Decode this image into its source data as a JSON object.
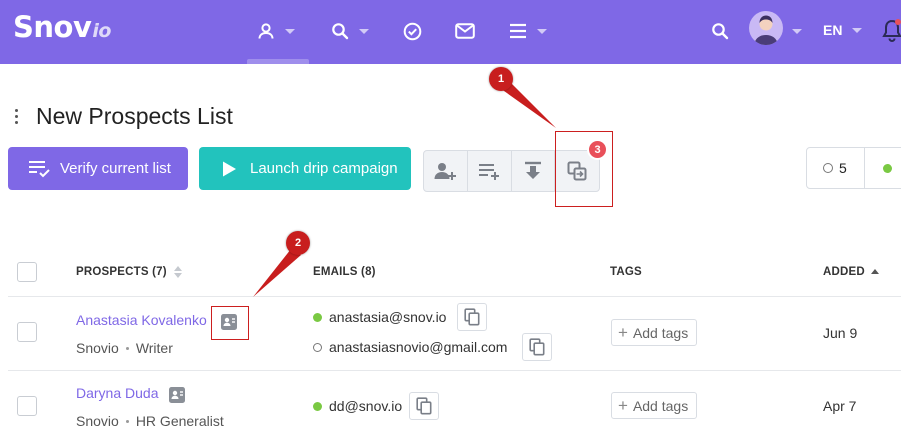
{
  "app": {
    "logo_main": "Snov",
    "logo_suffix": "io",
    "language": "EN"
  },
  "nav": {
    "items": [
      {
        "icon": "prospects-icon",
        "has_caret": true
      },
      {
        "icon": "search-icon",
        "has_caret": true
      },
      {
        "icon": "check-circle-icon",
        "has_caret": false
      },
      {
        "icon": "mail-icon",
        "has_caret": false
      },
      {
        "icon": "menu-icon",
        "has_caret": true
      }
    ],
    "right_icons": [
      "search-icon",
      "avatar",
      "bell-icon"
    ]
  },
  "page": {
    "title": "New Prospects List"
  },
  "toolbar": {
    "verify_label": "Verify current list",
    "launch_label": "Launch drip campaign",
    "tools": [
      "add-prospect-icon",
      "add-to-list-icon",
      "download-icon",
      "copy-move-icon"
    ],
    "tool_badge": "3",
    "counter_unverified": "5"
  },
  "table": {
    "headers": {
      "prospects": "PROSPECTS (7)",
      "emails": "EMAILS (8)",
      "tags": "TAGS",
      "added": "ADDED"
    },
    "rows": [
      {
        "name": "Anastasia Kovalenko",
        "company": "Snovio",
        "position": "Writer",
        "emails": [
          {
            "address": "anastasia@snov.io",
            "status": "valid"
          },
          {
            "address": "anastasiasnovio@gmail.com",
            "status": "unknown"
          }
        ],
        "tags_label": "Add tags",
        "added": "Jun 9"
      },
      {
        "name": "Daryna Duda",
        "company": "Snovio",
        "position": "HR Generalist",
        "emails": [
          {
            "address": "dd@snov.io",
            "status": "valid"
          }
        ],
        "tags_label": "Add tags",
        "added": "Apr 7"
      }
    ]
  },
  "annotations": {
    "marker_1": "1",
    "marker_2": "2",
    "colors": {
      "marker": "#c81e1e"
    }
  },
  "colors": {
    "brand": "#7f68e6",
    "teal": "#22c3bd",
    "valid": "#7ac943",
    "badge": "#e9505a"
  }
}
